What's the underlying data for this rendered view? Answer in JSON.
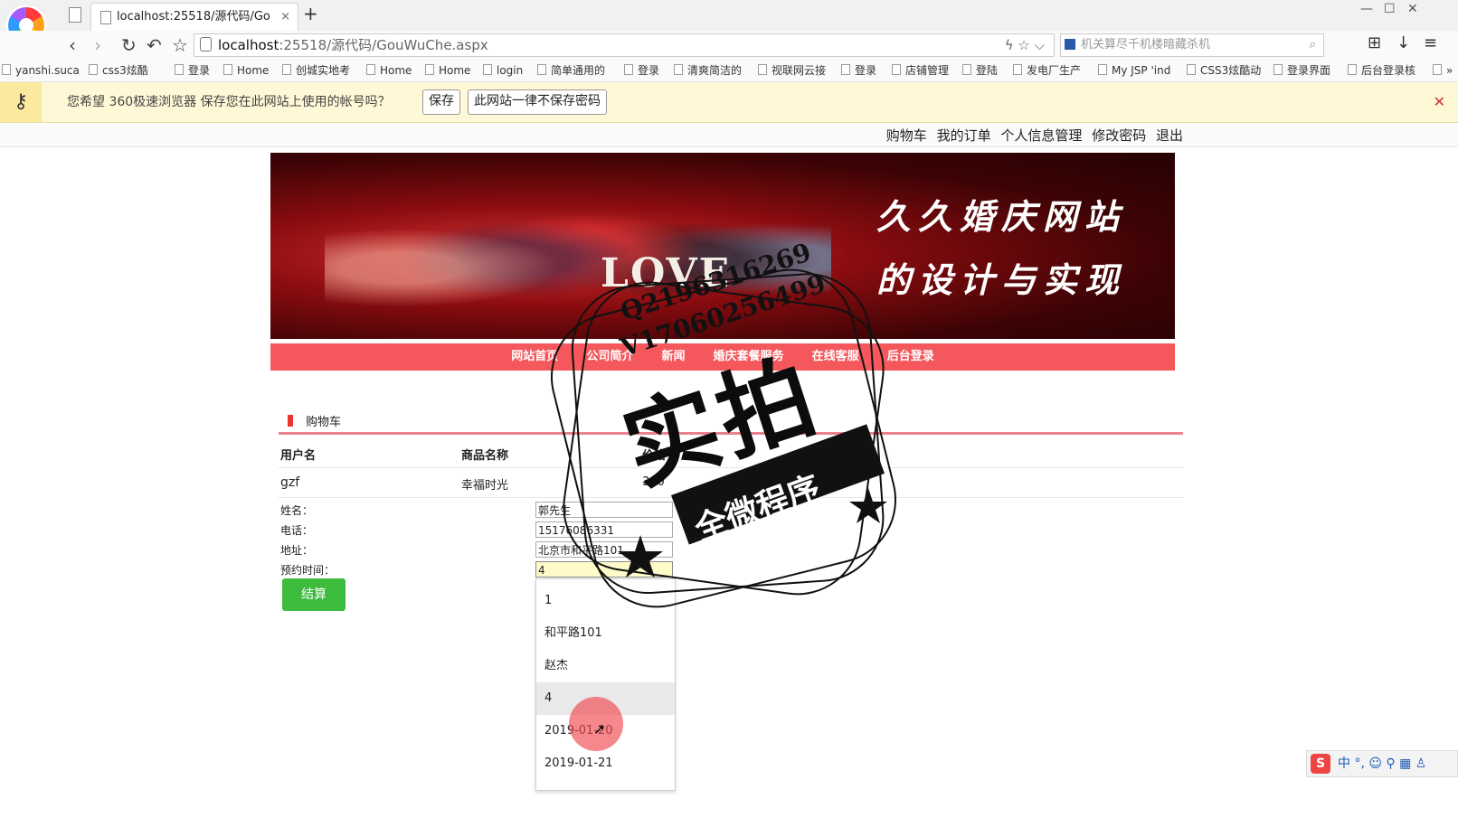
{
  "browser": {
    "tab_title": "localhost:25518/源代码/GouW",
    "tab_close": "×",
    "new_tab": "+",
    "back": "‹",
    "forward": "›",
    "reload": "↻",
    "undo": "↶",
    "star": "☆",
    "url_host": "localhost",
    "url_rest": ":25518/源代码/GouWuChe.aspx",
    "url_icons": "ϟ ☆ ⌵",
    "search_placeholder": "机关算尽千机楼暗藏杀机",
    "search_icon": "⌕",
    "win_min": "—",
    "win_max": "☐",
    "win_close": "✕",
    "tools": [
      "⊞",
      "↓",
      "≡"
    ],
    "bookmarks": [
      "yanshi.suca",
      "css3炫酷",
      "登录",
      "Home",
      "创城实地考",
      "Home",
      "Home",
      "login",
      "简单通用的",
      "登录",
      "清爽简洁的",
      "视联网云接",
      "登录",
      "店铺管理",
      "登陆",
      "发电厂生产",
      "My JSP 'ind",
      "CSS3炫酷动",
      "登录界面",
      "后台登录核"
    ],
    "bookmarks_more": "»"
  },
  "password_bar": {
    "message": "您希望 360极速浏览器 保存您在此网站上使用的帐号吗？",
    "save": "保存",
    "never": "此网站一律不保存密码",
    "close": "✕"
  },
  "topmenu": [
    "购物车",
    "我的订单",
    "个人信息管理",
    "修改密码",
    "退出"
  ],
  "banner": {
    "love": "LOVE",
    "title_line1": "久久婚庆网站",
    "title_line2": "的设计与实现"
  },
  "mainnav": [
    "网站首页",
    "公司简介",
    "新闻",
    "婚庆套餐服务",
    "在线客服",
    "后台登录"
  ],
  "cart": {
    "section_title": "购物车",
    "headers": [
      "用户名",
      "商品名称",
      "价格"
    ],
    "row": [
      "gzf",
      "幸福时光",
      "360"
    ]
  },
  "form": {
    "name_label": "姓名：",
    "name_value": "郭先生",
    "phone_label": "电话：",
    "phone_value": "15176086331",
    "address_label": "地址：",
    "address_value": "北京市和平路101",
    "time_label": "预约时间：",
    "time_value": "4",
    "checkout": "结算"
  },
  "autocomplete": [
    "1",
    "和平路101",
    "赵杰",
    "4",
    "2019-01-20",
    "2019-01-21"
  ],
  "watermark": {
    "qq": "Q2196316269",
    "v": "V17060256499",
    "big": "实拍",
    "ribbon": "全微程序"
  },
  "ime": {
    "logo": "S",
    "items": "中 °, ☺ ⚲ ▦ ♙"
  },
  "colors": {
    "nav_red": "#f4585c",
    "checkout_green": "#3dbb3d",
    "pw_bar": "#fff8d7"
  }
}
